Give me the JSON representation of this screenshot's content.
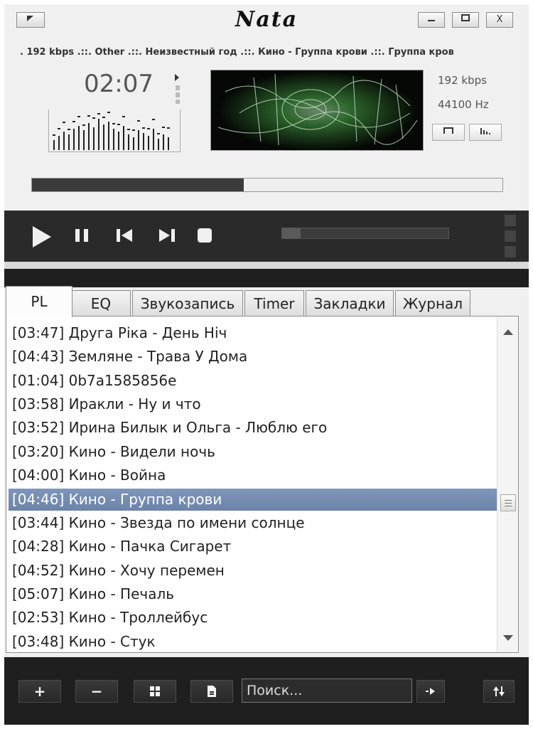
{
  "window": {
    "title": "Nata",
    "system_menu_icon": "corner-arrow-icon",
    "minimize_icon": "minimize-icon",
    "maximize_icon": "maximize-icon",
    "close_label": "X"
  },
  "marquee_text": ". 192 kbps .::. Other .::. Неизвестный год .::. Кино - Группа крови .::. Группа кров",
  "player": {
    "time": "02:07",
    "bitrate": "192 kbps",
    "samplerate": "44100 Hz",
    "progress_fraction": 0.45,
    "seek_fraction": 0.11
  },
  "tabs": [
    "PL",
    "EQ",
    "Звукозапись",
    "Timer",
    "Закладки",
    "Журнал"
  ],
  "active_tab": "PL",
  "playlist": [
    "[03:47] Друга Ріка - День Ніч",
    "[04:43] Земляне - Трава У Дома",
    "[01:04] 0b7a1585856e",
    "[03:58] Иракли - Ну и что",
    "[03:52] Ирина Билык и Ольга  - Люблю его",
    "[03:20] Кино - Видели ночь",
    "[04:00] Кино - Война",
    "[04:46] Кино - Группа крови",
    "[03:44] Кино - Звезда по имени солнце",
    "[04:28] Кино - Пачка Сигарет",
    "[04:52] Кино - Хочу перемен",
    "[05:07] Кино - Печаль",
    "[02:53] Кино - Троллейбус",
    "[03:48] Кино - Стук"
  ],
  "selected_index": 7,
  "bottom": {
    "add_label": "+",
    "remove_label": "−",
    "search_placeholder": "Поиск..."
  }
}
